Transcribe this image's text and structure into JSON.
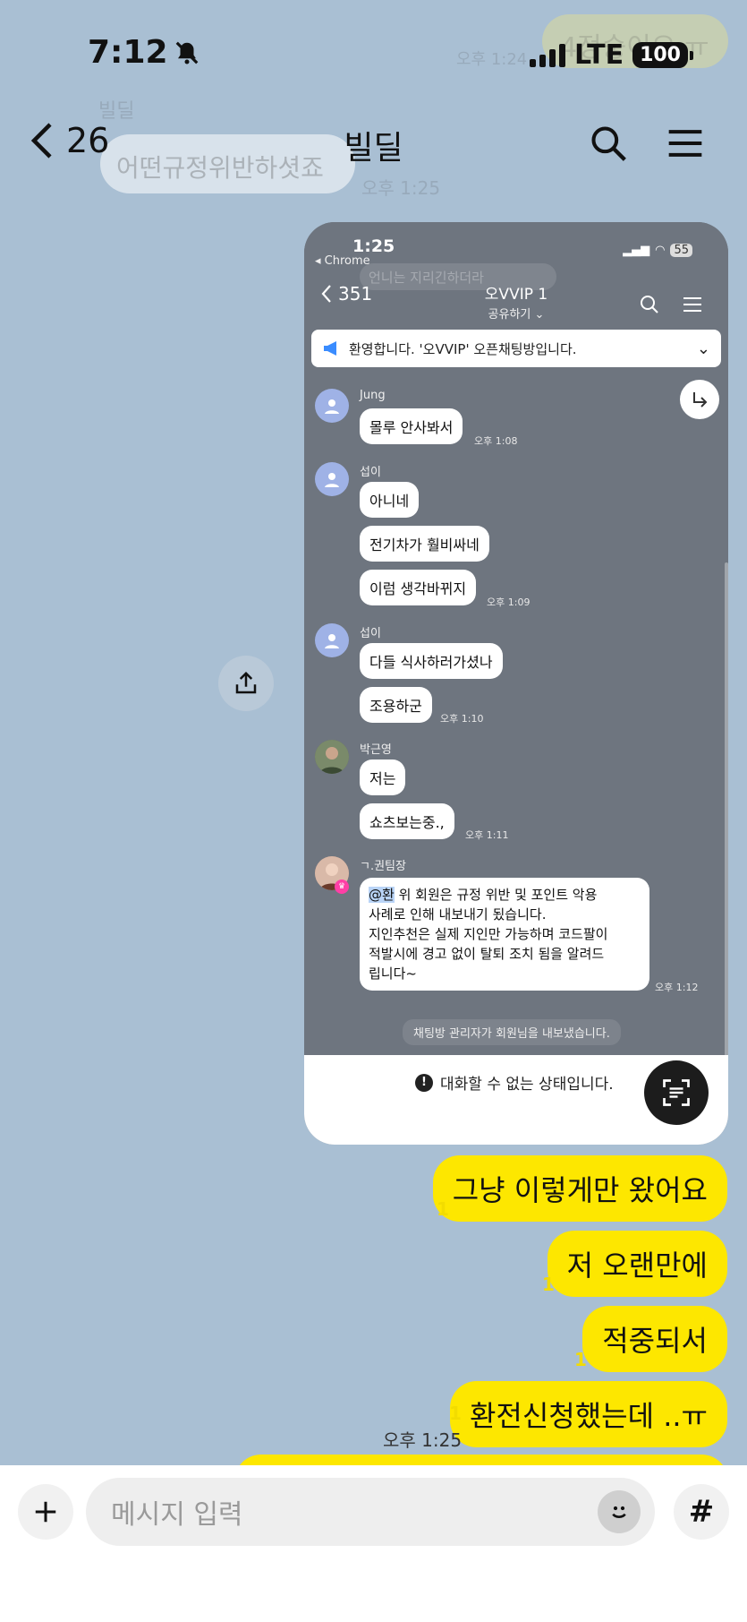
{
  "status_bar": {
    "time": "7:12",
    "network": "LTE",
    "battery": "100"
  },
  "nav": {
    "back_count": "26",
    "title": "빌딜"
  },
  "ghost": {
    "top_bubble": "4정숭이요 ㅠ",
    "top_time": "오후 1:24",
    "sender": "빌딜",
    "white_bubble": "어떤규정위반하셧죠",
    "time": "오후 1:25"
  },
  "screenshot": {
    "status_time": "1:25",
    "browser": "◂ Chrome",
    "battery": "55",
    "back_count": "351",
    "room_title": "오VVIP 1",
    "room_sub": "공유하기",
    "ghost_msg": "언니는 지리긴하더라",
    "notice": "환영합니다. '오VVIP' 오픈채팅방입니다.",
    "messages": [
      {
        "user": "Jung",
        "bubbles": [
          "몰루 안사봐서"
        ],
        "time": "오후 1:08"
      },
      {
        "user": "섭이",
        "bubbles": [
          "아니네",
          "전기차가 훨비싸네",
          "이럼 생각바뀌지"
        ],
        "time": "오후 1:09"
      },
      {
        "user": "섭이",
        "bubbles": [
          "다들 식사하러가셨나",
          "조용하군"
        ],
        "time": "오후 1:10"
      },
      {
        "user": "박근영",
        "bubbles": [
          "저는",
          "쇼츠보는중.,"
        ],
        "time": "오후 1:11"
      },
      {
        "user": "ㄱ.권팀장",
        "mention": "@환",
        "long_text": [
          "위 회원은 규정 위반 및 포인트 악용",
          "사례로 인해 내보내기 됬습니다.",
          "지인추천은 실제 지인만 가능하며 코드팔이",
          "적발시에 경고 없이 탈퇴 조치 됨을 알려드",
          "립니다~"
        ],
        "time": "오후 1:12"
      }
    ],
    "system_msg": "채팅방 관리자가 회원님을 내보냈습니다.",
    "blocked_msg": "대화할 수 없는 상태입니다."
  },
  "my_messages": [
    {
      "text": "그냥 이렇게만 왔어요",
      "unread": "1"
    },
    {
      "text": "저 오랜만에",
      "unread": "1"
    },
    {
      "text": "적중되서",
      "unread": "1"
    },
    {
      "text": "환전신청했는데 ..ㅠ",
      "unread": "1"
    }
  ],
  "last_time": "오후 1:25",
  "input": {
    "placeholder": "메시지 입력"
  },
  "colors": {
    "background": "#a9bfd3",
    "my_bubble": "#fde700",
    "unread": "#f2dc00"
  }
}
